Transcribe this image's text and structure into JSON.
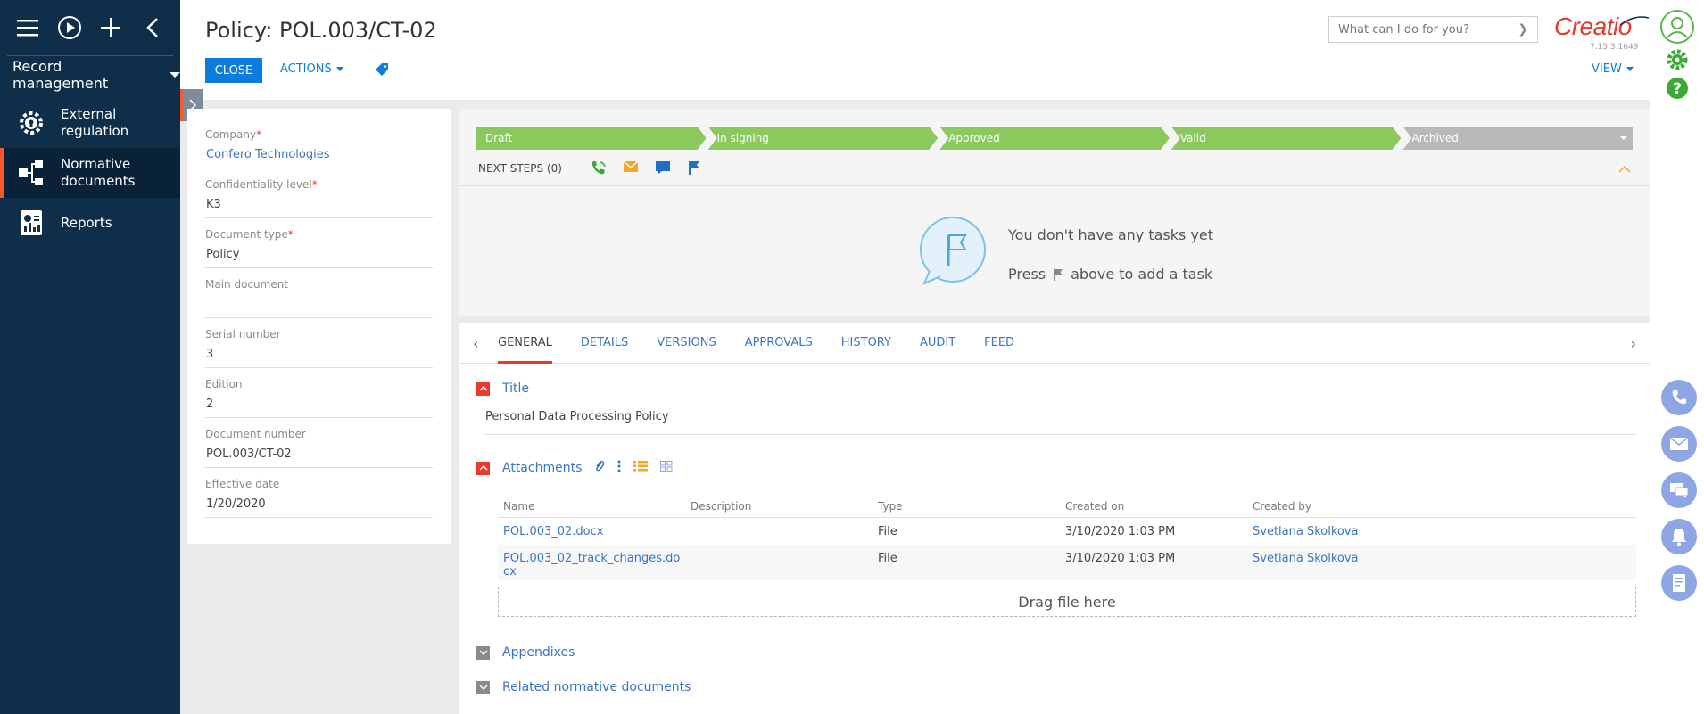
{
  "sidebar": {
    "section_label": "Record management",
    "items": [
      {
        "label": "External regulation",
        "icon": "gear-shield-icon"
      },
      {
        "label": "Normative documents",
        "icon": "structure-icon"
      },
      {
        "label": "Reports",
        "icon": "report-icon"
      }
    ]
  },
  "header": {
    "title": "Policy: POL.003/CT-02",
    "close_label": "CLOSE",
    "actions_label": "ACTIONS",
    "view_label": "VIEW",
    "search_placeholder": "What can I do for you?",
    "logo_text": "Creatio",
    "version": "7.15.3.1649"
  },
  "record": {
    "fields": [
      {
        "label": "Company",
        "required": true,
        "value": "Confero Technologies",
        "link": true
      },
      {
        "label": "Confidentiality level",
        "required": true,
        "value": "K3",
        "link": false
      },
      {
        "label": "Document type",
        "required": true,
        "value": "Policy",
        "link": false
      },
      {
        "label": "Main document",
        "required": false,
        "value": "",
        "link": false
      },
      {
        "label": "Serial number",
        "required": false,
        "value": "3",
        "link": false
      },
      {
        "label": "Edition",
        "required": false,
        "value": "2",
        "link": false
      },
      {
        "label": "Document number",
        "required": false,
        "value": "POL.003/CT-02",
        "link": false
      },
      {
        "label": "Effective date",
        "required": false,
        "value": "1/20/2020",
        "link": false
      }
    ]
  },
  "stages": [
    "Draft",
    "In signing",
    "Approved",
    "Valid",
    "Archived"
  ],
  "next_steps": {
    "label": "NEXT STEPS (0)",
    "empty_title": "You don't have any tasks yet",
    "hint_before": "Press",
    "hint_after": "above to add a task"
  },
  "tabs": [
    "GENERAL",
    "DETAILS",
    "VERSIONS",
    "APPROVALS",
    "HISTORY",
    "AUDIT",
    "FEED"
  ],
  "general": {
    "title_group": "Title",
    "title_value": "Personal Data Processing Policy",
    "attachments_group": "Attachments",
    "columns": [
      "Name",
      "Description",
      "Type",
      "Created on",
      "Created by"
    ],
    "rows": [
      {
        "name": "POL.003_02.docx",
        "description": "",
        "type": "File",
        "created_on": "3/10/2020 1:03 PM",
        "created_by": "Svetlana Skolkova"
      },
      {
        "name": "POL.003_02_track_changes.docx",
        "description": "",
        "type": "File",
        "created_on": "3/10/2020 1:03 PM",
        "created_by": "Svetlana Skolkova"
      }
    ],
    "dropzone": "Drag file here",
    "appendixes_group": "Appendixes",
    "related_group": "Related normative documents"
  },
  "colors": {
    "sidebar": "#0e2e4a",
    "accent": "#e8392c",
    "primary": "#0d7ddd",
    "stage": "#8bc95d",
    "stage_inactive": "#b9b9b9"
  }
}
